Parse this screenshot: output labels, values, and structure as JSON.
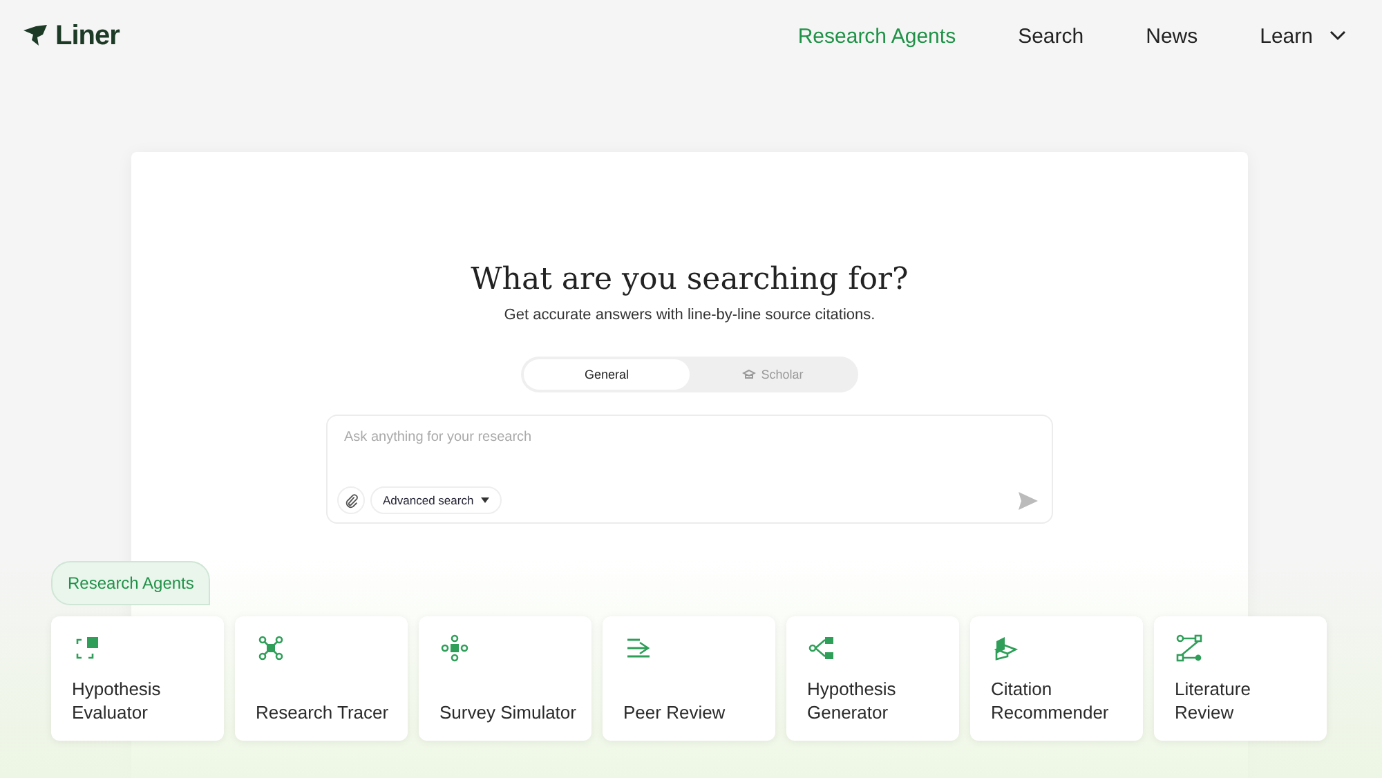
{
  "header": {
    "logo": "Liner",
    "nav": [
      {
        "label": "Research Agents",
        "selected": true,
        "dropdown": false
      },
      {
        "label": "Search",
        "selected": false,
        "dropdown": false
      },
      {
        "label": "News",
        "selected": false,
        "dropdown": false
      },
      {
        "label": "Learn",
        "selected": false,
        "dropdown": true
      }
    ]
  },
  "hero": {
    "title": "What are you searching for?",
    "subtitle": "Get accurate answers with line-by-line source citations.",
    "modes": [
      {
        "label": "General",
        "selected": true
      },
      {
        "label": "Scholar",
        "selected": false
      }
    ],
    "search": {
      "placeholder": "Ask anything for your research",
      "advanced": "Advanced search"
    }
  },
  "agents": {
    "label": "Research Agents",
    "items": [
      {
        "name": "Hypothesis Evaluator"
      },
      {
        "name": "Research Tracer"
      },
      {
        "name": "Survey Simulator"
      },
      {
        "name": "Peer Review"
      },
      {
        "name": "Hypothesis Generator"
      },
      {
        "name": "Citation Recommender"
      },
      {
        "name": "Literature Review"
      }
    ]
  }
}
